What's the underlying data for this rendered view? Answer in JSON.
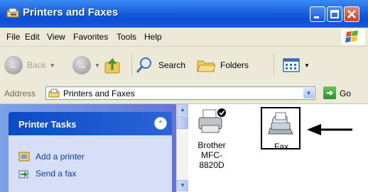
{
  "window": {
    "title": "Printers and Faxes"
  },
  "menu": {
    "items": [
      "File",
      "Edit",
      "View",
      "Favorites",
      "Tools",
      "Help"
    ]
  },
  "toolbar": {
    "back_label": "Back",
    "search_label": "Search",
    "folders_label": "Folders"
  },
  "address": {
    "label": "Address",
    "value": "Printers and Faxes",
    "go_label": "Go"
  },
  "tasks": {
    "title": "Printer Tasks",
    "items": [
      "Add a printer",
      "Send a fax"
    ]
  },
  "files": [
    {
      "line1": "Brother",
      "line2": "MFC-8820D",
      "icon": "printer-icon"
    },
    {
      "line1": "Fax",
      "icon": "fax-icon"
    }
  ],
  "colors": {
    "title_bar": "#0b4fd6",
    "task_header": "#0c4bc4",
    "task_link": "#0c3fa6",
    "task_pane": "#6f8ddf"
  }
}
